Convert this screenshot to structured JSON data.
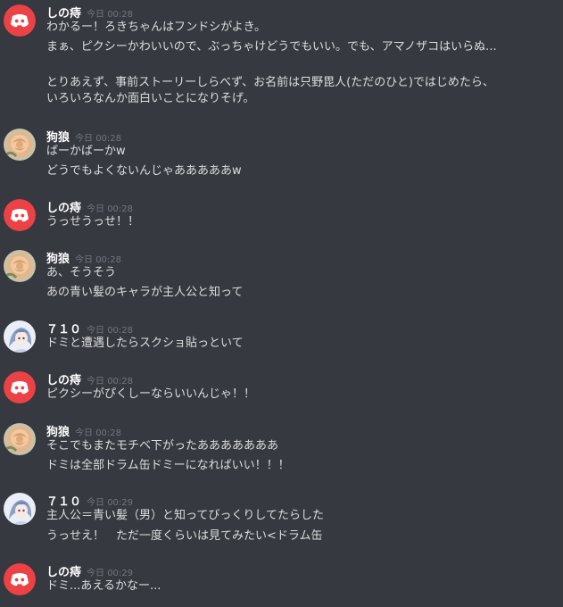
{
  "messages": [
    {
      "author": "しの痔",
      "avatar": "discord-logo",
      "timestamp": "今日 00:28",
      "lines": [
        "わかるー！ろきちゃんはフンドシがよき。",
        "まぁ、ピクシーかわいいので、ぶっちゃけどうでもいい。でも、アマノザコはいらぬ...",
        "",
        "とりあえず、事前ストーリーしらべず、お名前は只野毘人(ただのひと)ではじめたら、",
        "いろいろなんか面白いことになりそげ。"
      ]
    },
    {
      "author": "狗狼",
      "avatar": "rose-photo",
      "timestamp": "今日 00:28",
      "lines": [
        "ばーかばーかw",
        "どうでもよくないんじゃあああああw"
      ]
    },
    {
      "author": "しの痔",
      "avatar": "discord-logo",
      "timestamp": "今日 00:28",
      "lines": [
        "うっせうっせ！！"
      ]
    },
    {
      "author": "狗狼",
      "avatar": "rose-photo",
      "timestamp": "今日 00:28",
      "lines": [
        "あ、そうそう",
        "あの青い髪のキャラが主人公と知って"
      ]
    },
    {
      "author": "７１０",
      "avatar": "anime-character",
      "timestamp": "今日 00:28",
      "lines": [
        "ドミと遭遇したらスクショ貼っといて"
      ]
    },
    {
      "author": "しの痔",
      "avatar": "discord-logo",
      "timestamp": "今日 00:28",
      "lines": [
        "ピクシーがぴくしーならいいんじゃ！！"
      ]
    },
    {
      "author": "狗狼",
      "avatar": "rose-photo",
      "timestamp": "今日 00:28",
      "lines": [
        "そこでもまたモチベ下がったあああああああ",
        "ドミは全部ドラム缶ドミーになればいい！！！"
      ]
    },
    {
      "author": "７１０",
      "avatar": "anime-character",
      "timestamp": "今日 00:29",
      "lines": [
        "主人公＝青い髪（男）と知ってびっくりしてたらした",
        "うっせえ！　ただ一度くらいは見てみたい<ドラム缶"
      ]
    },
    {
      "author": "しの痔",
      "avatar": "discord-logo",
      "timestamp": "今日 00:29",
      "lines": [
        "ドミ...あえるかなー..."
      ]
    }
  ]
}
